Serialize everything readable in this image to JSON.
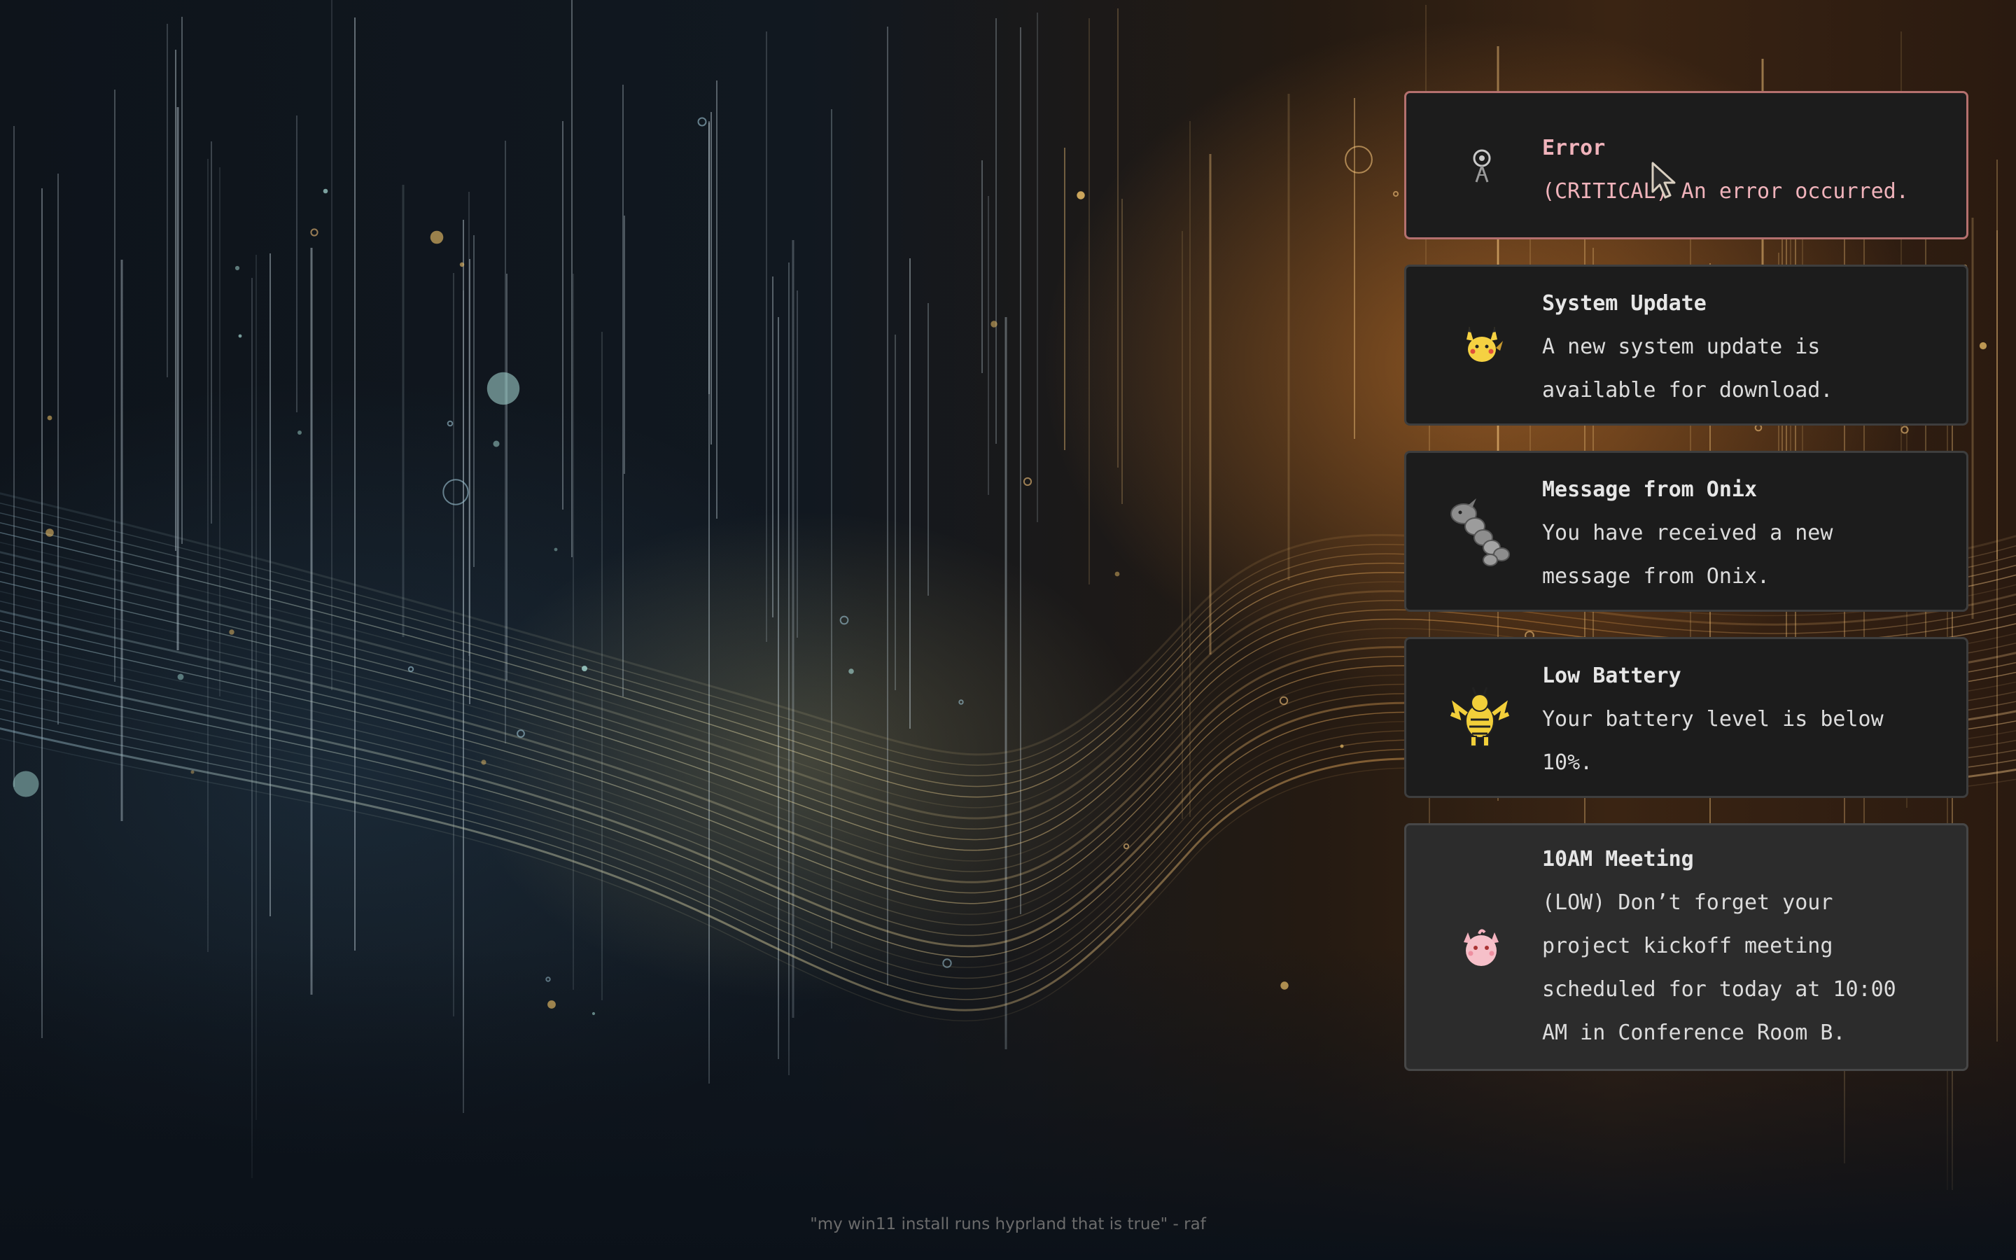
{
  "notifications": [
    {
      "urgency": "critical",
      "title": "Error",
      "body": "(CRITICAL) An error occurred.",
      "icon": "radar-tower-icon"
    },
    {
      "urgency": "normal",
      "title": "System Update",
      "body": "A new system update is\navailable for download.",
      "icon": "pikachu-icon"
    },
    {
      "urgency": "normal",
      "title": "Message from Onix",
      "body": "You have received a new\nmessage from Onix.",
      "icon": "onix-icon"
    },
    {
      "urgency": "normal",
      "title": "Low Battery",
      "body": "Your battery level is below\n10%.",
      "icon": "electabuzz-icon"
    },
    {
      "urgency": "low",
      "title": "10AM Meeting",
      "body": "(LOW) Don’t forget your\nproject kickoff meeting\nscheduled for today at 10:00\nAM in Conference Room B.",
      "icon": "clefairy-icon"
    }
  ],
  "wallpaper": {
    "quote": "\"my win11 install runs hyprland that is true\" - raf"
  },
  "colors": {
    "critical_border": "#b4706e",
    "critical_text": "#f0b3bb",
    "normal_bg": "#1c1c1c",
    "low_bg": "#2c2c2c",
    "text": "#dcdcdc"
  }
}
